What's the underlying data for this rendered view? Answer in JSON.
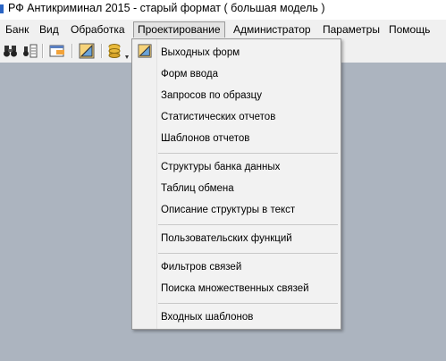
{
  "window": {
    "title": "РФ Антикриминал 2015 - старый формат ( большая модель )"
  },
  "menubar": {
    "items": [
      "Банк",
      "Вид",
      "Обработка",
      "Проектирование",
      "Администратор",
      "Параметры",
      "Помощь"
    ],
    "active": "Проектирование"
  },
  "toolbar": {
    "buttons": [
      "binoculars-icon",
      "binoculars-list-icon",
      "window-icon",
      "design-ruler-icon",
      "database-icon"
    ]
  },
  "dropdown": {
    "groups": [
      [
        "Выходных форм",
        "Форм ввода",
        "Запросов по образцу",
        "Статистических отчетов",
        "Шаблонов отчетов"
      ],
      [
        "Структуры банка данных",
        "Таблиц обмена",
        "Описание структуры в текст"
      ],
      [
        "Пользовательских функций"
      ],
      [
        "Фильтров связей",
        "Поиска множественных связей"
      ],
      [
        "Входных шаблонов"
      ]
    ]
  }
}
